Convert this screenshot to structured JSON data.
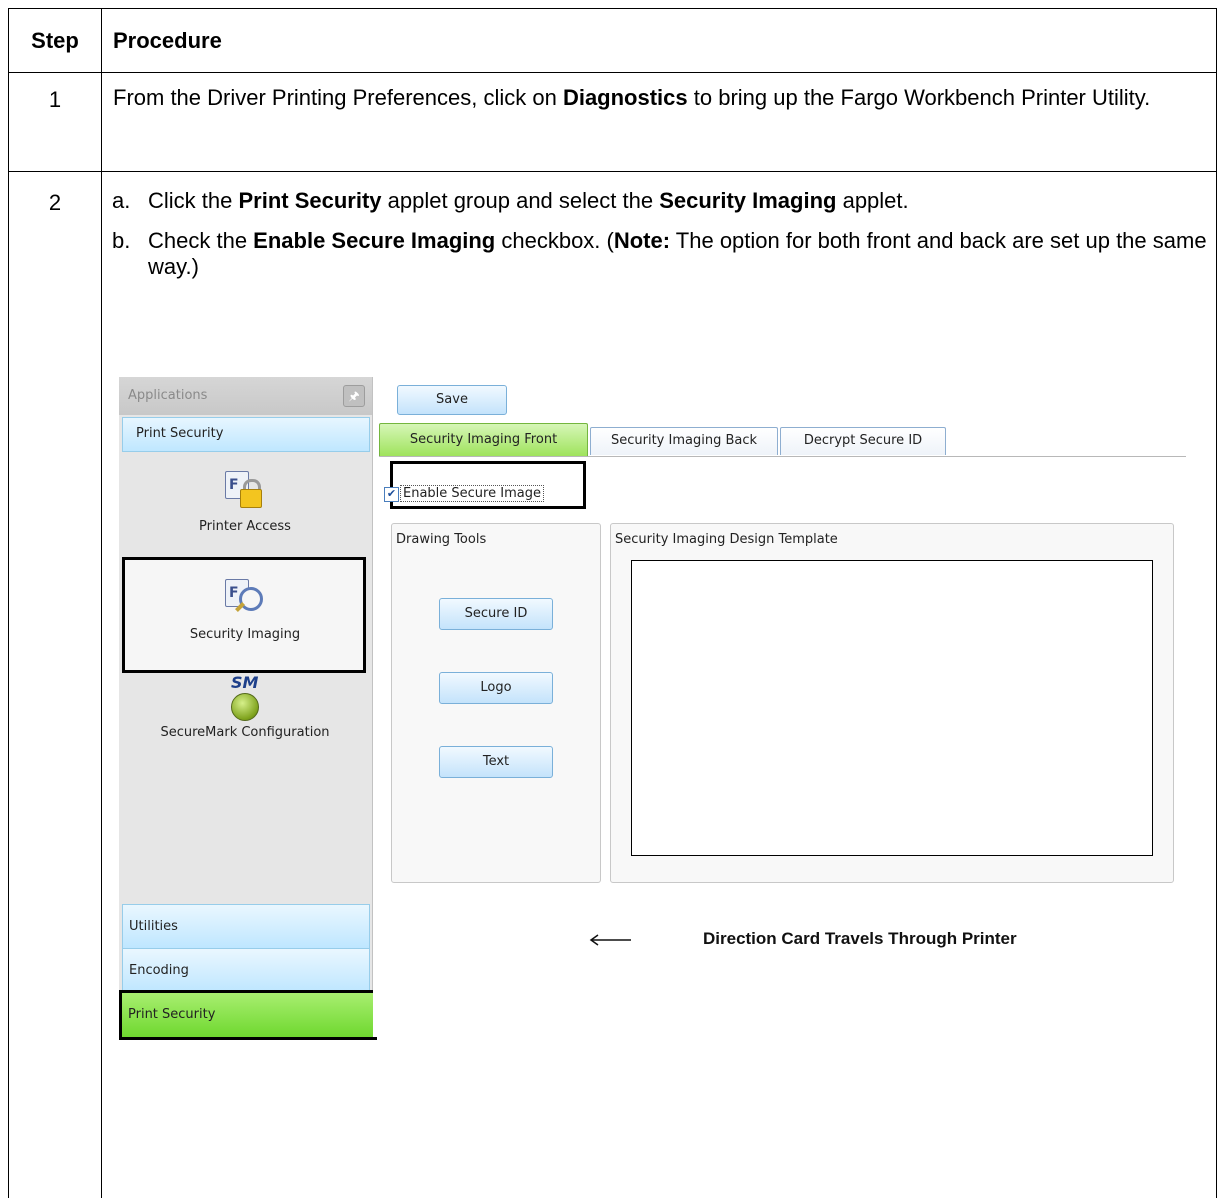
{
  "table": {
    "header_step": "Step",
    "header_procedure": "Procedure"
  },
  "row1": {
    "step": "1",
    "text_before": "From the Driver Printing Preferences, click on ",
    "bold": "Diagnostics",
    "text_after": " to bring up the Fargo Workbench Printer Utility."
  },
  "row2": {
    "step": "2",
    "a_marker": "a.",
    "a_text1": "Click the ",
    "a_bold1": "Print Security",
    "a_text2": " applet group and select the ",
    "a_bold2": "Security Imaging",
    "a_text3": " applet.",
    "b_marker": "b.",
    "b_text1": "Check the ",
    "b_bold1": "Enable Secure Imaging",
    "b_text2": " checkbox. (",
    "b_bold2": "Note:",
    "b_text3": "  The option for both front and back are set up the same way.)"
  },
  "screenshot": {
    "sidebar": {
      "header": "Applications",
      "group": "Print Security",
      "items": [
        {
          "label": "Printer Access",
          "icon": "lock-document-icon"
        },
        {
          "label": "Security Imaging",
          "icon": "magnifier-document-icon"
        },
        {
          "label": "SecureMark Configuration",
          "icon": "securemark-icon",
          "icon_text": "SM"
        }
      ],
      "nav": [
        "Utilities",
        "Encoding",
        "Print Security"
      ]
    },
    "save_label": "Save",
    "tabs": [
      "Security Imaging Front",
      "Security Imaging Back",
      "Decrypt Secure ID"
    ],
    "enable_label": "Enable Secure Image",
    "enable_checked": true,
    "drawing_tools_title": "Drawing Tools",
    "tools": [
      "Secure ID",
      "Logo",
      "Text"
    ],
    "template_title": "Security Imaging Design Template",
    "direction_text": "Direction Card Travels Through Printer"
  }
}
